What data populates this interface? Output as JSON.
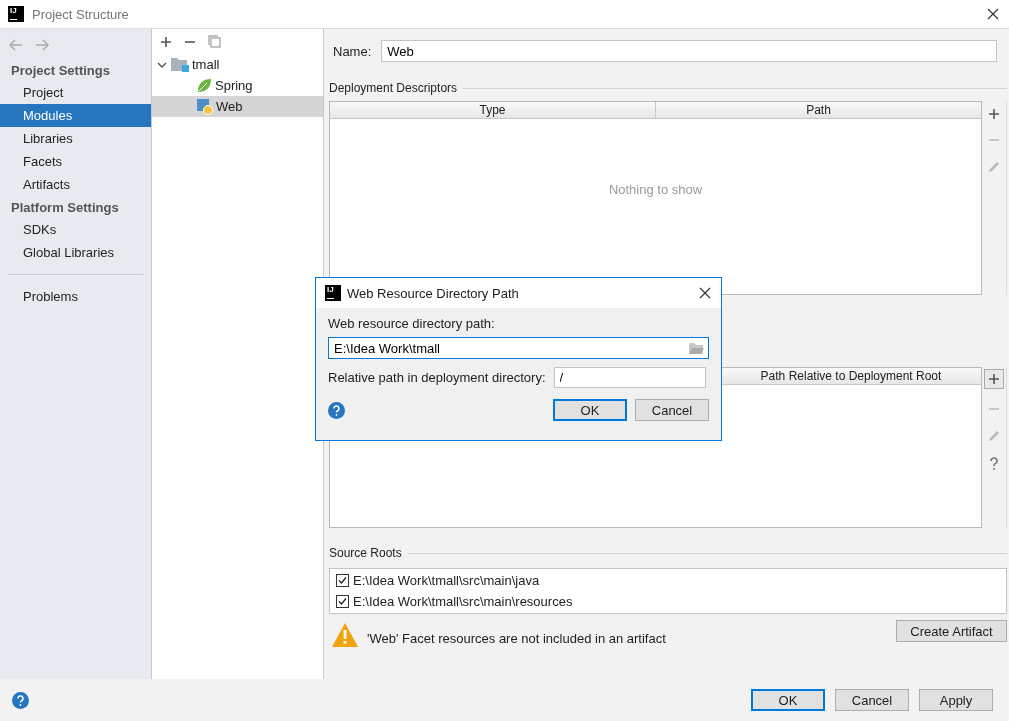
{
  "window": {
    "logo": "IJ",
    "title": "Project Structure"
  },
  "sidebar": {
    "sections": [
      {
        "heading": "Project Settings",
        "items": [
          {
            "label": "Project",
            "selected": false
          },
          {
            "label": "Modules",
            "selected": true
          },
          {
            "label": "Libraries",
            "selected": false
          },
          {
            "label": "Facets",
            "selected": false
          },
          {
            "label": "Artifacts",
            "selected": false
          }
        ]
      },
      {
        "heading": "Platform Settings",
        "items": [
          {
            "label": "SDKs",
            "selected": false
          },
          {
            "label": "Global Libraries",
            "selected": false
          }
        ]
      }
    ],
    "extra_items": [
      {
        "label": "Problems",
        "selected": false
      }
    ]
  },
  "tree": {
    "nodes": [
      {
        "label": "tmall",
        "kind": "folder",
        "expanded": true,
        "selected": false,
        "children": [
          {
            "label": "Spring",
            "kind": "spring",
            "selected": false
          },
          {
            "label": "Web",
            "kind": "web",
            "selected": true
          }
        ]
      }
    ]
  },
  "name_field": {
    "label": "Name:",
    "value": "Web"
  },
  "deployment_descriptors": {
    "title": "Deployment Descriptors",
    "columns": [
      "Type",
      "Path"
    ],
    "empty_text": "Nothing to show"
  },
  "web_resource_directories": {
    "columns": [
      "Path Relative to Deployment Root"
    ]
  },
  "source_roots": {
    "title": "Source Roots",
    "items": [
      {
        "path": "E:\\Idea Work\\tmall\\src\\main\\java",
        "checked": true
      },
      {
        "path": "E:\\Idea Work\\tmall\\src\\main\\resources",
        "checked": true
      }
    ]
  },
  "warning": {
    "text": "'Web' Facet resources are not included in an artifact",
    "button": "Create Artifact"
  },
  "footer": {
    "buttons": [
      {
        "label": "OK",
        "default": true
      },
      {
        "label": "Cancel",
        "default": false
      },
      {
        "label": "Apply",
        "default": false
      }
    ]
  },
  "dialog": {
    "logo": "IJ",
    "title": "Web Resource Directory Path",
    "path_label": "Web resource directory path:",
    "path_value": "E:\\Idea Work\\tmall",
    "relative_label": "Relative path in deployment directory:",
    "relative_value": "/",
    "buttons": [
      {
        "label": "OK",
        "default": true
      },
      {
        "label": "Cancel",
        "default": false
      }
    ]
  }
}
